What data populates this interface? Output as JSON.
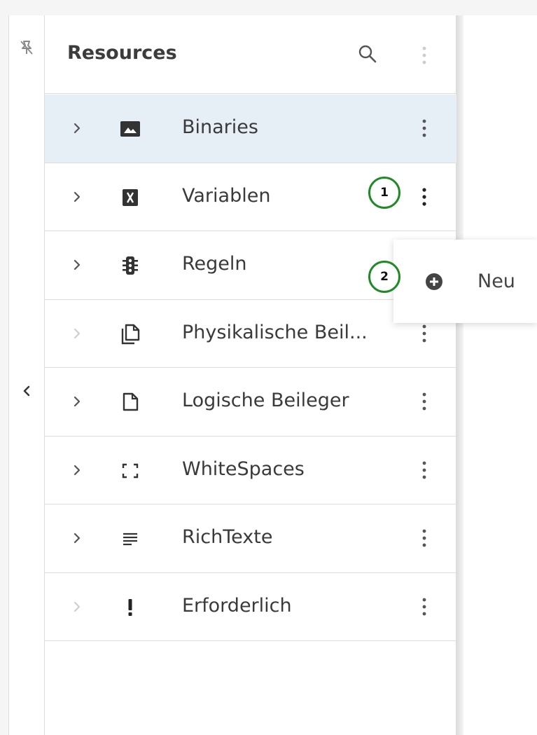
{
  "panel": {
    "title": "Resources"
  },
  "rows": [
    {
      "label": "Binaries",
      "icon": "image-icon",
      "expand_enabled": true,
      "selected": true
    },
    {
      "label": "Variablen",
      "icon": "variable-icon",
      "expand_enabled": true,
      "selected": false
    },
    {
      "label": "Regeln",
      "icon": "traffic-light-icon",
      "expand_enabled": true,
      "selected": false
    },
    {
      "label": "Physikalische Beil...",
      "icon": "copy-pages-icon",
      "expand_enabled": false,
      "selected": false
    },
    {
      "label": "Logische Beileger",
      "icon": "page-icon",
      "expand_enabled": true,
      "selected": false
    },
    {
      "label": "WhiteSpaces",
      "icon": "crop-frame-icon",
      "expand_enabled": true,
      "selected": false
    },
    {
      "label": "RichTexte",
      "icon": "text-lines-icon",
      "expand_enabled": true,
      "selected": false
    },
    {
      "label": "Erforderlich",
      "icon": "exclamation-icon",
      "expand_enabled": false,
      "selected": false
    }
  ],
  "context_menu": {
    "items": [
      {
        "label": "Neu",
        "icon": "add-circle-icon"
      }
    ]
  },
  "callouts": {
    "step1": "1",
    "step2": "2",
    "color": "#1f8a26"
  },
  "colors": {
    "selected_row_bg": "#e6eef6",
    "divider": "#dcdcdc",
    "text": "#3a3a3a"
  }
}
